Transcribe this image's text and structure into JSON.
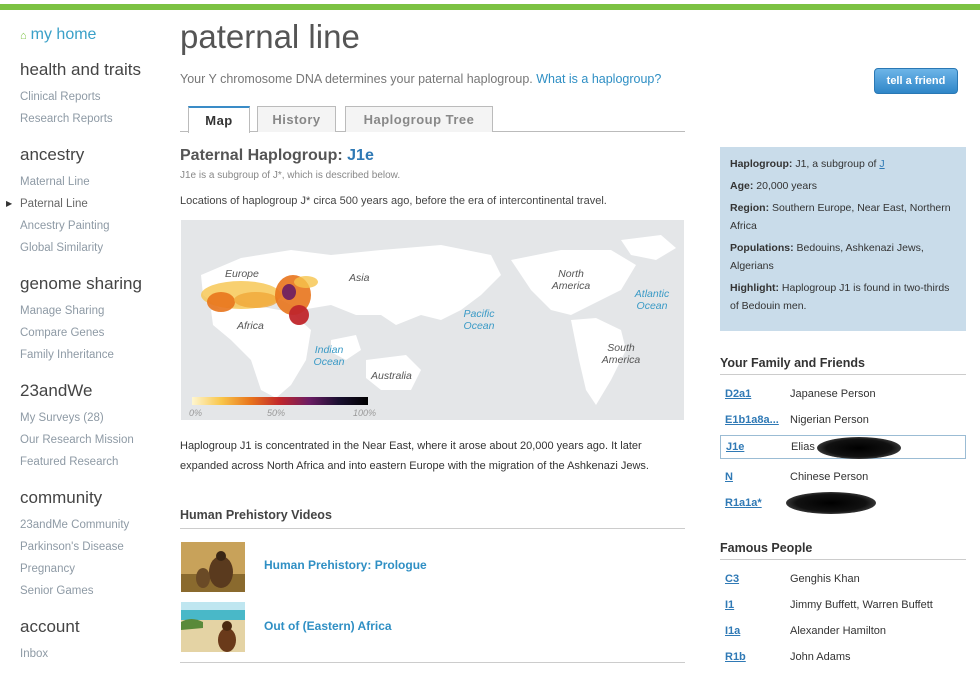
{
  "sidebar": {
    "home": "my home",
    "sections": [
      {
        "title": "health and traits",
        "items": [
          "Clinical Reports",
          "Research Reports"
        ]
      },
      {
        "title": "ancestry",
        "items": [
          "Maternal Line",
          "Paternal Line",
          "Ancestry Painting",
          "Global Similarity"
        ]
      },
      {
        "title": "genome sharing",
        "items": [
          "Manage Sharing",
          "Compare Genes",
          "Family Inheritance"
        ]
      },
      {
        "title": "23andWe",
        "items": [
          "My Surveys (28)",
          "Our Research Mission",
          "Featured Research"
        ]
      },
      {
        "title": "community",
        "items": [
          "23andMe Community",
          "Parkinson's Disease",
          "Pregnancy",
          "Senior Games"
        ]
      },
      {
        "title": "account",
        "items": [
          "Inbox"
        ]
      }
    ]
  },
  "page": {
    "title": "paternal line",
    "intro": "Your Y chromosome DNA determines your paternal haplogroup.",
    "intro_link": "What is a haplogroup?",
    "tell_friend": "tell a friend"
  },
  "tabs": [
    "Map",
    "History",
    "Haplogroup Tree"
  ],
  "haplogroup": {
    "label": "Paternal Haplogroup:",
    "name": "J1e",
    "subtitle": "J1e is a subgroup of J*, which is described below.",
    "locations": "Locations of haplogroup J* circa 500 years ago, before the era of intercontinental travel.",
    "description": "Haplogroup J1 is concentrated in the Near East, where it arose about 20,000 years ago. It later expanded across North Africa and into eastern Europe with the migration of the Ashkenazi Jews."
  },
  "map": {
    "labels": {
      "europe": "Europe",
      "asia": "Asia",
      "africa": "Africa",
      "north_america": "North America",
      "south_america": "South America",
      "australia": "Australia",
      "pacific": "Pacific Ocean",
      "atlantic": "Atlantic Ocean",
      "indian": "Indian Ocean"
    },
    "legend": [
      "0%",
      "50%",
      "100%"
    ]
  },
  "info": {
    "haplogroup_label": "Haplogroup:",
    "haplogroup_value": "J1, a subgroup of",
    "haplogroup_link": "J",
    "age_label": "Age:",
    "age_value": "20,000 years",
    "region_label": "Region:",
    "region_value": "Southern Europe, Near East, Northern Africa",
    "pop_label": "Populations:",
    "pop_value": "Bedouins, Ashkenazi Jews, Algerians",
    "highlight_label": "Highlight:",
    "highlight_value": "Haplogroup J1 is found in two-thirds of Bedouin men."
  },
  "family": {
    "title": "Your Family and Friends",
    "rows": [
      {
        "hg": "D2a1",
        "name": "Japanese Person"
      },
      {
        "hg": "E1b1a8a...",
        "name": "Nigerian Person"
      },
      {
        "hg": "J1e",
        "name": "Elias"
      },
      {
        "hg": "N",
        "name": "Chinese Person"
      },
      {
        "hg": "R1a1a*",
        "name": ""
      }
    ]
  },
  "famous": {
    "title": "Famous People",
    "rows": [
      {
        "hg": "C3",
        "name": "Genghis Khan"
      },
      {
        "hg": "I1",
        "name": "Jimmy Buffett, Warren Buffett"
      },
      {
        "hg": "I1a",
        "name": "Alexander Hamilton"
      },
      {
        "hg": "R1b",
        "name": "John Adams"
      }
    ]
  },
  "videos": {
    "title": "Human Prehistory Videos",
    "items": [
      "Human Prehistory: Prologue",
      "Out of (Eastern) Africa"
    ]
  },
  "colors": {
    "accent": "#2f79b5",
    "green": "#7cc243",
    "infobox": "#c9dcea"
  }
}
